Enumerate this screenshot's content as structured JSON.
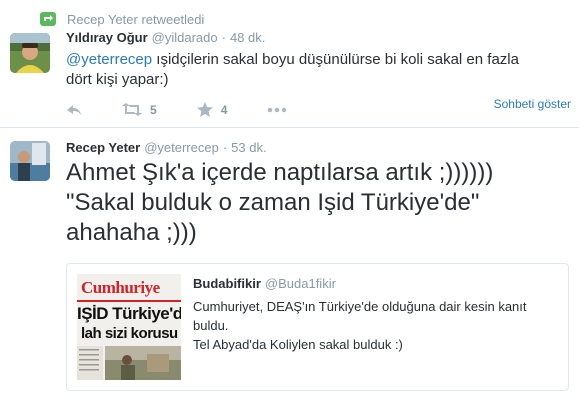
{
  "colors": {
    "link": "#2b7bb9",
    "muted": "#8899a6",
    "retweet_green": "#5bb85d",
    "text": "#292f33",
    "border": "#e1e8ed",
    "newspaper_red": "#d3222a"
  },
  "retweet_context": {
    "icon": "retweet-icon",
    "text": "Recep Yeter retweetledi"
  },
  "tweet1": {
    "fullname": "Yıldıray Oğur",
    "username": "@yildarado",
    "separator": "·",
    "time": "48 dk.",
    "mention": "@yeterrecep",
    "text_line1_rest": " ışidçilerin sakal boyu düşünülürse bi koli sakal en fazla",
    "text_line2": "dört kişi yapar:)",
    "actions": {
      "reply_icon": "reply-icon",
      "retweet_icon": "retweet-icon",
      "retweet_count": "5",
      "favorite_icon": "star-icon",
      "favorite_count": "4",
      "more_icon": "more-icon"
    },
    "conversation_link": "Sohbeti göster"
  },
  "tweet2": {
    "fullname": "Recep Yeter",
    "username": "@yeterrecep",
    "separator": "·",
    "time": "53 dk.",
    "text_line1": "Ahmet Şık'a içerde naptılarsa artık ;))))))",
    "text_line2": "\"Sakal bulduk o zaman Işid Türkiye'de\"",
    "text_line3": "ahahaha ;)))",
    "quote": {
      "fullname": "Budabifikir",
      "username": "@Buda1fikir",
      "text_line1": "Cumhuriyet, DEAŞ'ın Türkiye'de olduğuna dair kesin kanıt",
      "text_line2": "buldu.",
      "text_line3": "Tel Abyad'da Koliylen sakal bulduk :)",
      "image": {
        "masthead": "Cumhuriye",
        "headline1": "IŞİD Türkiye'd",
        "headline2": "lah sizi korusu"
      }
    }
  }
}
